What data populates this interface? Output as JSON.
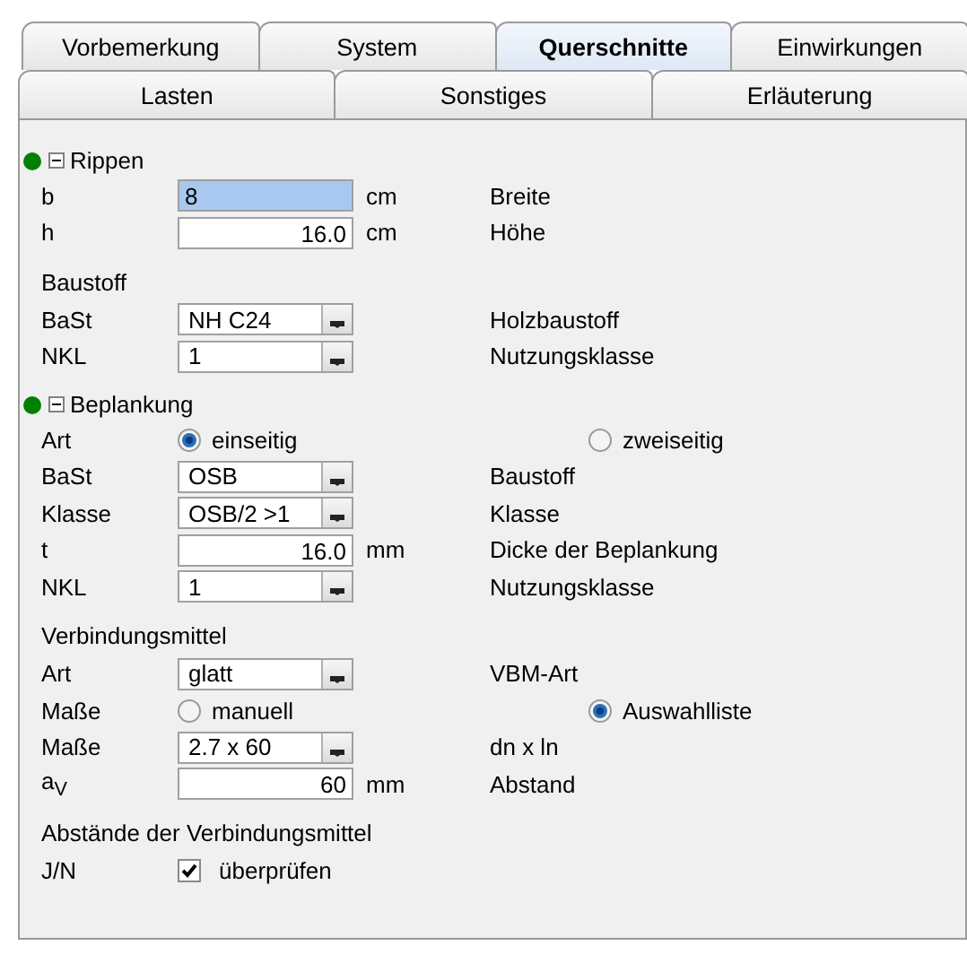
{
  "tab_rows": [
    {
      "tabs": [
        {
          "label": "Vorbemerkung",
          "selected": false
        },
        {
          "label": "System",
          "selected": false
        },
        {
          "label": "Querschnitte",
          "selected": true
        },
        {
          "label": "Einwirkungen",
          "selected": false
        }
      ]
    },
    {
      "tabs": [
        {
          "label": "Lasten",
          "selected": false
        },
        {
          "label": "Sonstiges",
          "selected": false
        },
        {
          "label": "Erläuterung",
          "selected": false
        }
      ]
    }
  ],
  "sections": [
    {
      "title": "Rippen",
      "expanded": true,
      "color": "#008000",
      "rows": [
        {
          "kind": "input",
          "label": "b",
          "value": "8",
          "highlighted": true,
          "unit": "cm",
          "description": "Breite"
        },
        {
          "kind": "input",
          "label": "h",
          "value": "16.0",
          "highlighted": false,
          "unit": "cm",
          "description": "Höhe"
        },
        {
          "kind": "subheading",
          "text": "Baustoff"
        },
        {
          "kind": "combo",
          "label": "BaSt",
          "value": "NH C24",
          "description": "Holzbaustoff"
        },
        {
          "kind": "combo",
          "label": "NKL",
          "value": "1",
          "description": "Nutzungsklasse"
        }
      ]
    },
    {
      "title": "Beplankung",
      "expanded": true,
      "color": "#008000",
      "rows": [
        {
          "kind": "radio",
          "label": "Art",
          "options": [
            {
              "label": "einseitig",
              "selected": true
            },
            {
              "label": "zweiseitig",
              "selected": false
            }
          ]
        },
        {
          "kind": "combo",
          "label": "BaSt",
          "value": "OSB",
          "description": "Baustoff"
        },
        {
          "kind": "combo",
          "label": "Klasse",
          "value": "OSB/2 >1",
          "description": "Klasse"
        },
        {
          "kind": "input",
          "label": "t",
          "value": "16.0",
          "highlighted": false,
          "unit": "mm",
          "description": "Dicke der Beplankung"
        },
        {
          "kind": "combo",
          "label": "NKL",
          "value": "1",
          "description": "Nutzungsklasse"
        },
        {
          "kind": "subheading",
          "text": "Verbindungsmittel"
        },
        {
          "kind": "combo",
          "label": "Art",
          "value": "glatt",
          "description": "VBM-Art"
        },
        {
          "kind": "radio",
          "label": "Maße",
          "options": [
            {
              "label": "manuell",
              "selected": false
            },
            {
              "label": "Auswahlliste",
              "selected": true
            }
          ]
        },
        {
          "kind": "combo",
          "label": "Maße",
          "value": "2.7 x  60",
          "description": "dn x ln"
        },
        {
          "kind": "input",
          "label": "a$_{V}$",
          "value": "60",
          "highlighted": false,
          "unit": "mm",
          "description": "Abstand"
        },
        {
          "kind": "subheading",
          "text": "Abstände der Verbindungsmittel"
        },
        {
          "kind": "check",
          "label": "J/N",
          "checked": true,
          "text": "überprüfen"
        }
      ]
    }
  ]
}
